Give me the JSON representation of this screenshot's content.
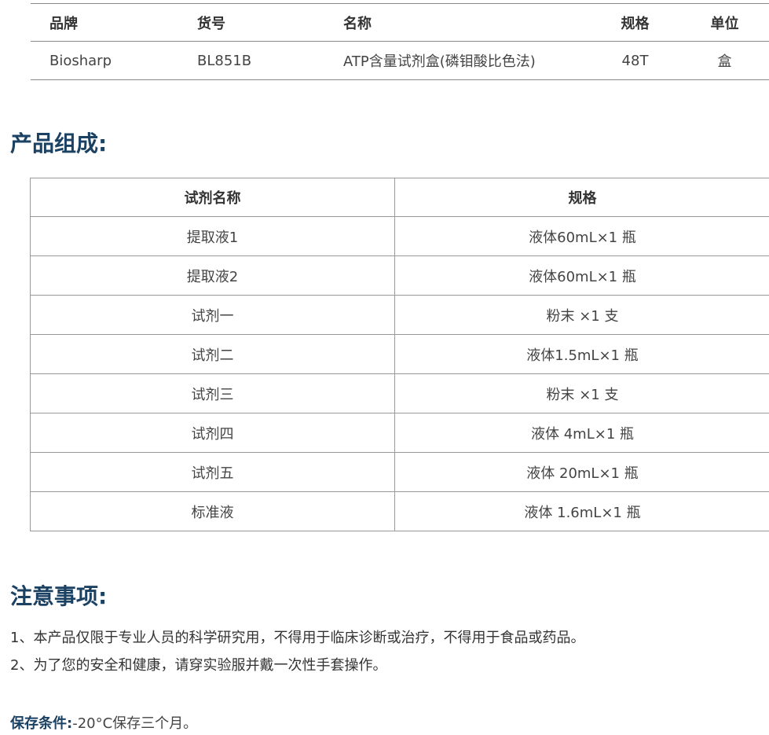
{
  "product_info": {
    "headers": [
      "品牌",
      "货号",
      "名称",
      "规格",
      "单位"
    ],
    "row": [
      "Biosharp",
      "BL851B",
      "ATP含量试剂盒(磷钼酸比色法)",
      "48T",
      "盒"
    ]
  },
  "composition": {
    "title": "产品组成:",
    "headers": [
      "试剂名称",
      "规格"
    ],
    "rows": [
      [
        "提取液1",
        "液体60mL×1 瓶"
      ],
      [
        "提取液2",
        "液体60mL×1 瓶"
      ],
      [
        "试剂一",
        "粉末 ×1 支"
      ],
      [
        "试剂二",
        "液体1.5mL×1 瓶"
      ],
      [
        "试剂三",
        "粉末 ×1 支"
      ],
      [
        "试剂四",
        "液体 4mL×1 瓶"
      ],
      [
        "试剂五",
        "液体 20mL×1 瓶"
      ],
      [
        "标准液",
        "液体 1.6mL×1 瓶"
      ]
    ]
  },
  "notes": {
    "title": "注意事项:",
    "items": [
      "1、本产品仅限于专业人员的科学研究用，不得用于临床诊断或治疗，不得用于食品或药品。",
      "2、为了您的安全和健康，请穿实验服并戴一次性手套操作。"
    ]
  },
  "storage": {
    "label": "保存条件:",
    "value": "-20°C保存三个月。"
  }
}
